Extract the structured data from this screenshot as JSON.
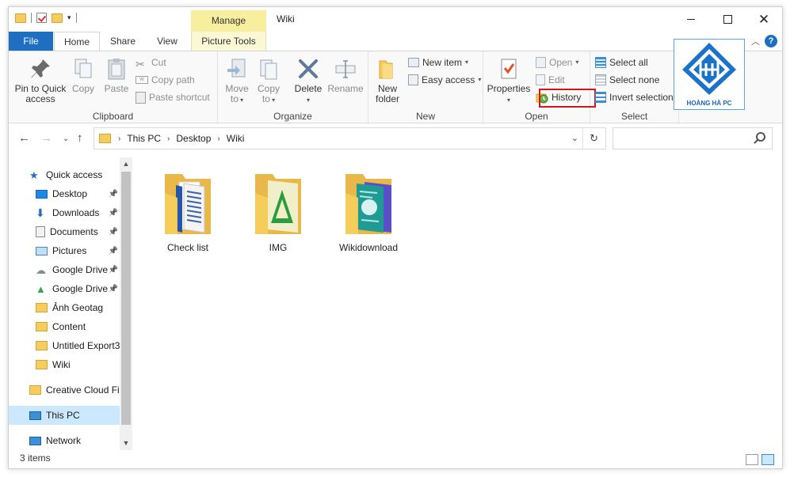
{
  "titlebar": {
    "manage_label": "Manage",
    "window_title": "Wiki"
  },
  "tabs": {
    "file": "File",
    "home": "Home",
    "share": "Share",
    "view": "View",
    "picture_tools": "Picture Tools"
  },
  "ribbon": {
    "clipboard": {
      "label": "Clipboard",
      "pin_to_quick_access": [
        "Pin to Quick",
        "access"
      ],
      "copy": "Copy",
      "paste": "Paste",
      "cut": "Cut",
      "copy_path": "Copy path",
      "paste_shortcut": "Paste shortcut"
    },
    "organize": {
      "label": "Organize",
      "move_to": [
        "Move",
        "to"
      ],
      "copy_to": [
        "Copy",
        "to"
      ],
      "delete": "Delete",
      "rename": "Rename"
    },
    "new": {
      "label": "New",
      "new_folder": [
        "New",
        "folder"
      ],
      "new_item": "New item",
      "easy_access": "Easy access"
    },
    "open": {
      "label": "Open",
      "properties": "Properties",
      "open": "Open",
      "edit": "Edit",
      "history": "History"
    },
    "select": {
      "label": "Select",
      "select_all": "Select all",
      "select_none": "Select none",
      "invert_selection": "Invert selection"
    }
  },
  "logo": {
    "text": "HOÀNG HÀ PC"
  },
  "address": {
    "crumbs": [
      "This PC",
      "Desktop",
      "Wiki"
    ]
  },
  "search": {
    "placeholder": ""
  },
  "navpane": {
    "items": [
      {
        "label": "Quick access",
        "icon": "star-icon",
        "pinned": false
      },
      {
        "label": "Desktop",
        "icon": "desktop-icon",
        "pinned": true
      },
      {
        "label": "Downloads",
        "icon": "download-icon",
        "pinned": true
      },
      {
        "label": "Documents",
        "icon": "document-icon",
        "pinned": true
      },
      {
        "label": "Pictures",
        "icon": "pictures-icon",
        "pinned": true
      },
      {
        "label": "Google Drive",
        "icon": "cloud-icon",
        "pinned": true
      },
      {
        "label": "Google Drive",
        "icon": "drive-icon",
        "pinned": true
      },
      {
        "label": "Ảnh Geotag",
        "icon": "folder-icon",
        "pinned": false
      },
      {
        "label": "Content",
        "icon": "folder-icon",
        "pinned": false
      },
      {
        "label": "Untitled Export3",
        "icon": "folder-icon",
        "pinned": false
      },
      {
        "label": "Wiki",
        "icon": "folder-icon",
        "pinned": false
      },
      {
        "label": "Creative Cloud Fil",
        "icon": "creative-cloud-icon",
        "pinned": false
      },
      {
        "label": "This PC",
        "icon": "computer-icon",
        "pinned": false,
        "selected": true
      },
      {
        "label": "Network",
        "icon": "network-icon",
        "pinned": false
      }
    ]
  },
  "content": {
    "items": [
      {
        "label": "Check list"
      },
      {
        "label": "IMG"
      },
      {
        "label": "Wikidownload"
      }
    ]
  },
  "status": {
    "item_count": "3 items"
  },
  "colors": {
    "accent": "#1e6fc0",
    "manage": "#f7ef9e",
    "highlight": "#d4151b",
    "selection": "#cce8ff"
  }
}
